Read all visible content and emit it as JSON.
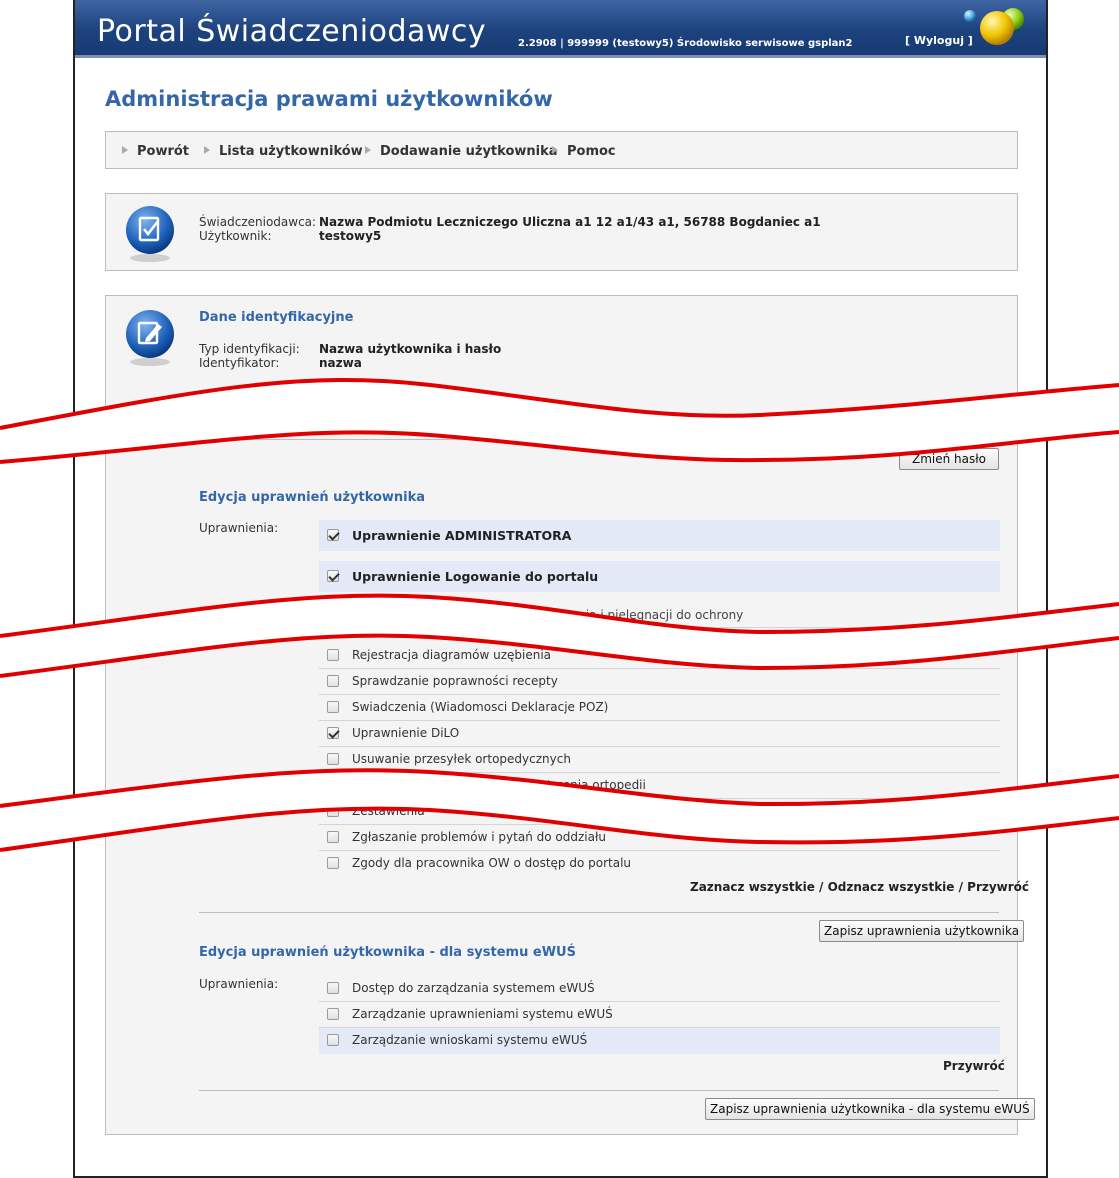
{
  "header": {
    "brand": "Portal Świadczeniodawcy",
    "version": "2.2908 | 999999 (testowy5) Środowisko serwisowe gsplan2",
    "logout": "[ Wyloguj ]"
  },
  "page": {
    "title": "Administracja prawami użytkowników"
  },
  "nav": {
    "items": [
      "Powrót",
      "Lista użytkowników",
      "Dodawanie użytkownika",
      "Pomoc"
    ]
  },
  "provider_box": {
    "provider_label": "Świadczeniodawca:",
    "provider_value": "Nazwa Podmiotu Leczniczego Uliczna a1 12 a1/43 a1, 56788 Bogdaniec a1",
    "user_label": "Użytkownik:",
    "user_value": "testowy5"
  },
  "identity": {
    "title": "Dane identyfikacyjne",
    "type_label": "Typ identyfikacji:",
    "type_value": "Nazwa użytkownika i hasło",
    "id_label": "Identyfikator:",
    "id_value": "nazwa",
    "change_password": "Zmień hasło"
  },
  "permissions": {
    "title": "Edycja uprawnień użytkownika",
    "label": "Uprawnienia:",
    "top_items": [
      {
        "label": "Uprawnienie ADMINISTRATORA",
        "checked": true
      },
      {
        "label": "Uprawnienie Logowanie do portalu",
        "checked": true
      }
    ],
    "partial_item": "...do zgłaszania zdarzeń do zaopatrzenia i pielęgnacji do ochrony",
    "items": [
      {
        "label": "Rejestracja diagramów uzębienia",
        "checked": false
      },
      {
        "label": "Sprawdzanie poprawności recepty",
        "checked": false
      },
      {
        "label": "Swiadczenia (Wiadomosci Deklaracje POZ)",
        "checked": false
      },
      {
        "label": "Uprawnienie DiLO",
        "checked": true
      },
      {
        "label": "Usuwanie przesyłek ortopedycznych",
        "checked": false
      },
      {
        "label": "Zestawienia refundacyjne zaopatrzenia ortopedii",
        "checked": false
      },
      {
        "label": "Zestawienia",
        "checked": false
      },
      {
        "label": "Zgłaszanie problemów i pytań do oddziału",
        "checked": false
      },
      {
        "label": "Zgody dla pracownika OW o dostęp do portalu",
        "checked": false
      }
    ],
    "links": "Zaznacz wszystkie / Odznacz wszystkie / Przywróć",
    "save": "Zapisz uprawnienia użytkownika"
  },
  "ewus": {
    "title": "Edycja uprawnień użytkownika - dla systemu eWUŚ",
    "label": "Uprawnienia:",
    "items": [
      {
        "label": "Dostęp do zarządzania systemem eWUŚ",
        "checked": false
      },
      {
        "label": "Zarządzanie uprawnieniami systemu eWUŚ",
        "checked": false
      },
      {
        "label": "Zarządzanie wnioskami systemu eWUŚ",
        "checked": false
      }
    ],
    "restore": "Przywróć",
    "save": "Zapisz uprawnienia użytkownika - dla systemu eWUŚ"
  },
  "colors": {
    "accent": "#3467a8",
    "header": "#1d427e",
    "wave": "#e00000"
  }
}
